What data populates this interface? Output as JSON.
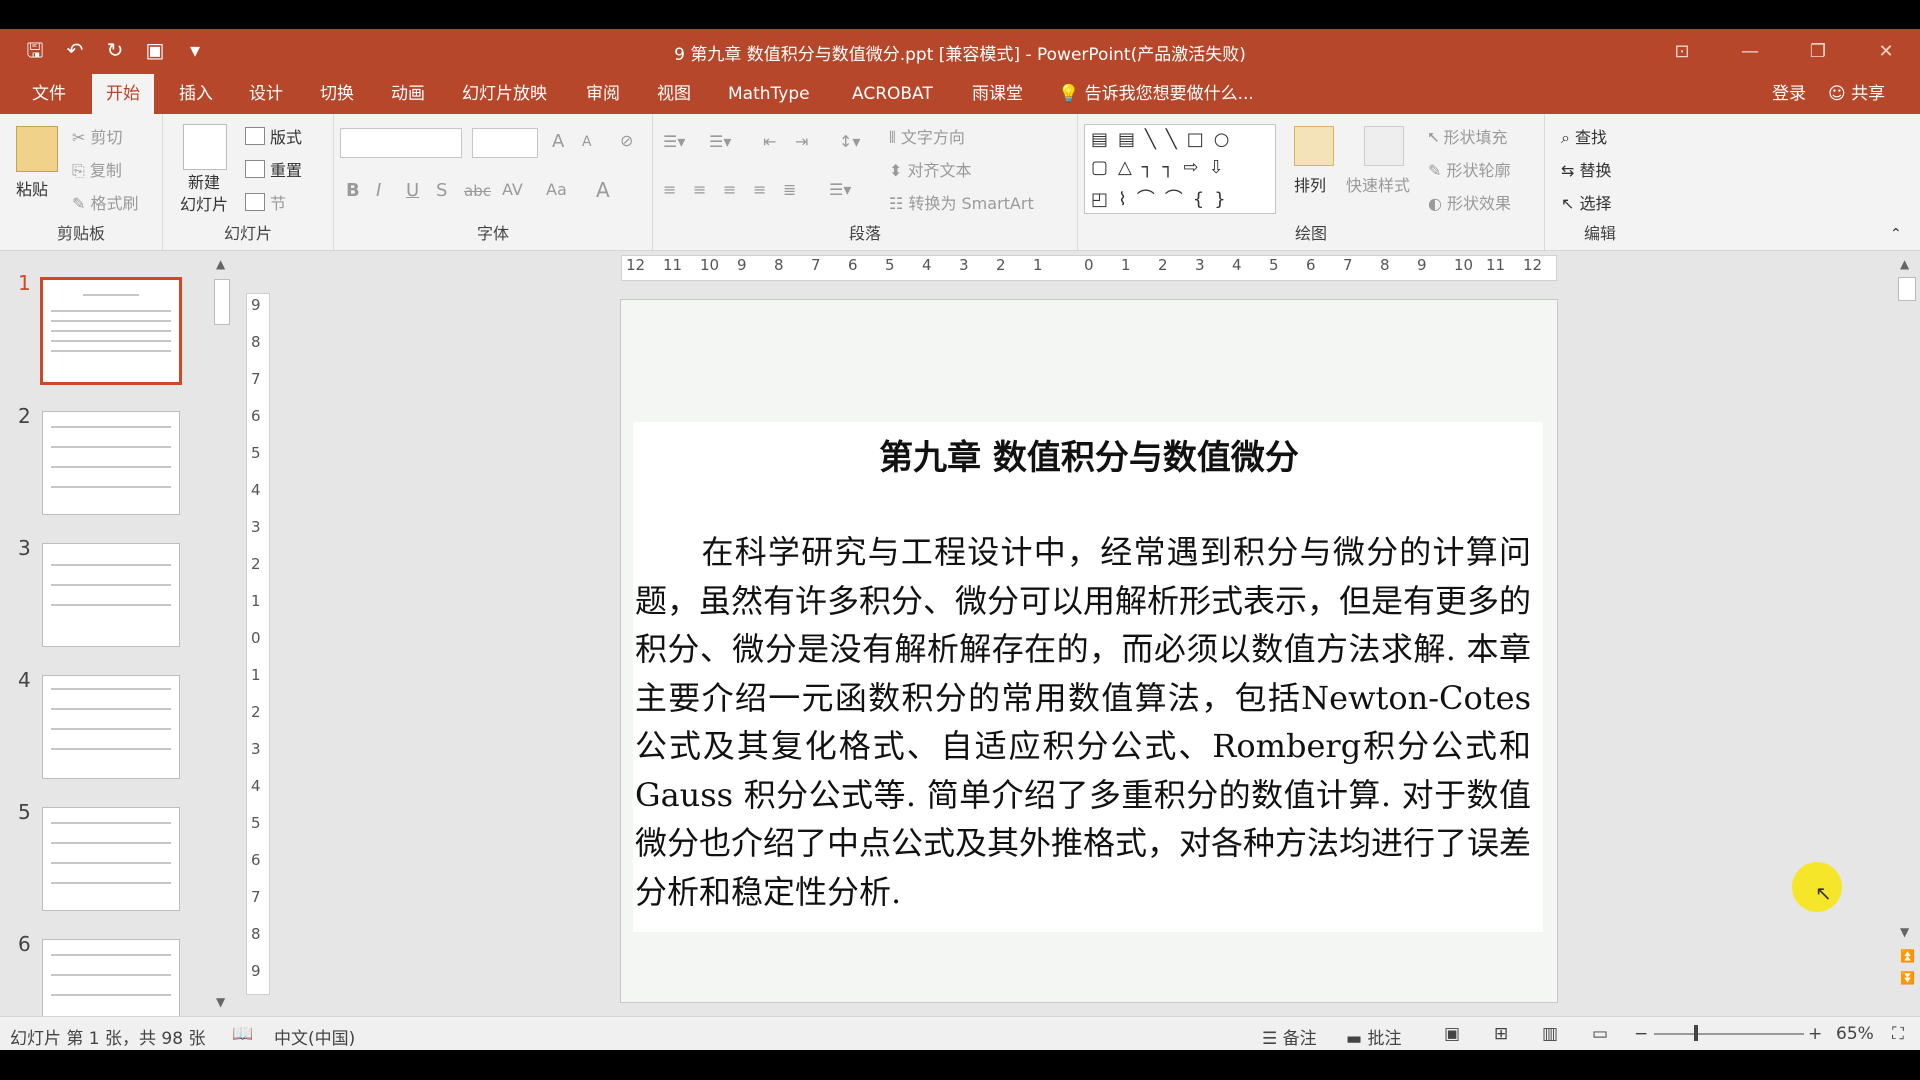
{
  "window": {
    "title": "9 第九章 数值积分与数值微分.ppt [兼容模式] - PowerPoint(产品激活失败)",
    "minimize": "—",
    "restore": "❐",
    "close": "✕",
    "ribbon_display": "⊡"
  },
  "tabs": [
    "文件",
    "开始",
    "插入",
    "设计",
    "切换",
    "动画",
    "幻灯片放映",
    "审阅",
    "视图",
    "MathType",
    "ACROBAT",
    "雨课堂"
  ],
  "active_tab": "开始",
  "tell_me": "告诉我您想要做什么...",
  "login": "登录",
  "share": "共享",
  "ribbon": {
    "clipboard": {
      "label": "剪贴板",
      "paste": "粘贴",
      "cut": "剪切",
      "copy": "复制",
      "format_painter": "格式刷"
    },
    "slides": {
      "label": "幻灯片",
      "new_slide": "新建\n幻灯片",
      "layout": "版式",
      "reset": "重置",
      "section": "节"
    },
    "font": {
      "label": "字体",
      "bold": "B",
      "italic": "I",
      "underline": "U",
      "shadow": "S",
      "strike": "abc",
      "spacing": "AV",
      "case": "Aa",
      "color": "A",
      "grow": "A",
      "shrink": "A"
    },
    "paragraph": {
      "label": "段落",
      "text_direction": "文字方向",
      "align_text": "对齐文本",
      "smartart": "转换为 SmartArt"
    },
    "drawing": {
      "label": "绘图",
      "arrange": "排列",
      "quick_styles": "快速样式",
      "shape_fill": "形状填充",
      "shape_outline": "形状轮廓",
      "shape_effects": "形状效果"
    },
    "editing": {
      "label": "编辑",
      "find": "查找",
      "replace": "替换",
      "select": "选择"
    }
  },
  "thumbnails": [
    {
      "num": "1",
      "active": true
    },
    {
      "num": "2",
      "active": false
    },
    {
      "num": "3",
      "active": false
    },
    {
      "num": "4",
      "active": false
    },
    {
      "num": "5",
      "active": false
    },
    {
      "num": "6",
      "active": false
    }
  ],
  "ruler": {
    "horizontal": [
      "12",
      "11",
      "10",
      "9",
      "8",
      "7",
      "6",
      "5",
      "4",
      "3",
      "2",
      "1",
      "0",
      "1",
      "2",
      "3",
      "4",
      "5",
      "6",
      "7",
      "8",
      "9",
      "10",
      "11",
      "12"
    ],
    "vertical": [
      "9",
      "8",
      "7",
      "6",
      "5",
      "4",
      "3",
      "2",
      "1",
      "0",
      "1",
      "2",
      "3",
      "4",
      "5",
      "6",
      "7",
      "8",
      "9"
    ]
  },
  "slide": {
    "title": "第九章  数值积分与数值微分",
    "body": "　　在科学研究与工程设计中，经常遇到积分与微分的计算问题，虽然有许多积分、微分可以用解析形式表示，但是有更多的积分、微分是没有解析解存在的，而必须以数值方法求解.  本章主要介绍一元函数积分的常用数值算法，包括Newton-Cotes 公式及其复化格式、自适应积分公式、Romberg积分公式和 Gauss 积分公式等. 简单介绍了多重积分的数值计算. 对于数值微分也介绍了中点公式及其外推格式，对各种方法均进行了误差分析和稳定性分析."
  },
  "status": {
    "slide_info": "幻灯片 第 1 张，共 98 张",
    "language": "中文(中国)",
    "notes": "备注",
    "comments": "批注",
    "zoom": "65%",
    "zoom_minus": "−",
    "zoom_plus": "+"
  },
  "colors": {
    "accent": "#b7472a",
    "thumb_selected": "#d24726",
    "cursor_highlight": "#f6e62a"
  }
}
